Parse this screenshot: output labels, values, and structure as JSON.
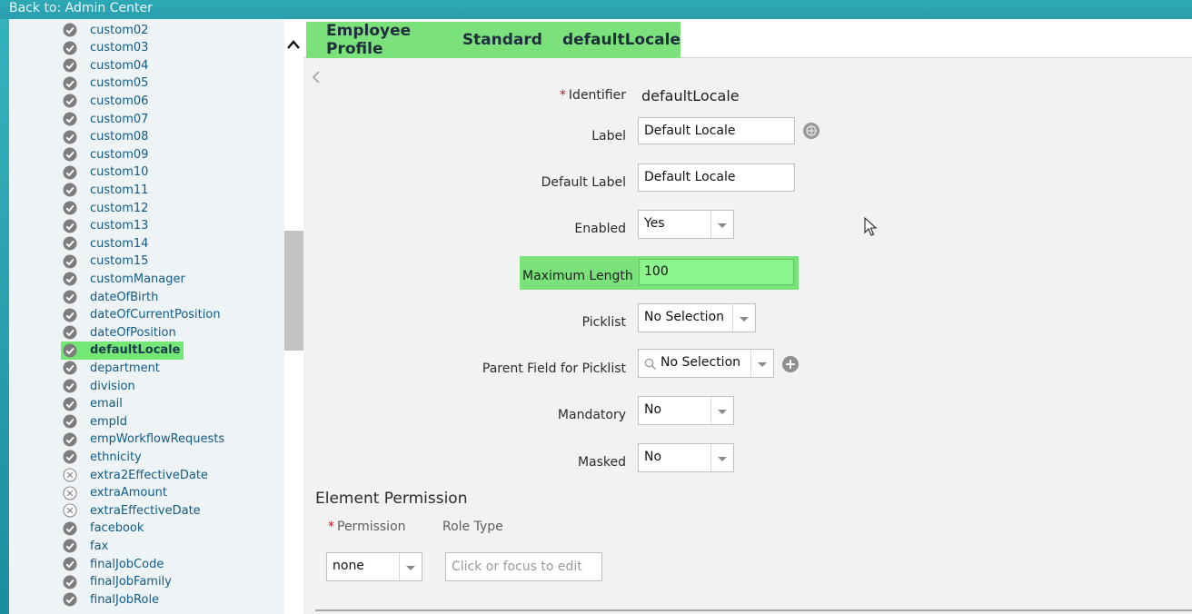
{
  "topbar": {
    "back_link": "Back to: Admin Center"
  },
  "sidebar": {
    "items": [
      {
        "label": "custom02",
        "status": "check"
      },
      {
        "label": "custom03",
        "status": "check"
      },
      {
        "label": "custom04",
        "status": "check"
      },
      {
        "label": "custom05",
        "status": "check"
      },
      {
        "label": "custom06",
        "status": "check"
      },
      {
        "label": "custom07",
        "status": "check"
      },
      {
        "label": "custom08",
        "status": "check"
      },
      {
        "label": "custom09",
        "status": "check"
      },
      {
        "label": "custom10",
        "status": "check"
      },
      {
        "label": "custom11",
        "status": "check"
      },
      {
        "label": "custom12",
        "status": "check"
      },
      {
        "label": "custom13",
        "status": "check"
      },
      {
        "label": "custom14",
        "status": "check"
      },
      {
        "label": "custom15",
        "status": "check"
      },
      {
        "label": "customManager",
        "status": "check"
      },
      {
        "label": "dateOfBirth",
        "status": "check"
      },
      {
        "label": "dateOfCurrentPosition",
        "status": "check"
      },
      {
        "label": "dateOfPosition",
        "status": "check"
      },
      {
        "label": "defaultLocale",
        "status": "check",
        "selected": true
      },
      {
        "label": "department",
        "status": "check"
      },
      {
        "label": "division",
        "status": "check"
      },
      {
        "label": "email",
        "status": "check"
      },
      {
        "label": "empId",
        "status": "check"
      },
      {
        "label": "empWorkflowRequests",
        "status": "check"
      },
      {
        "label": "ethnicity",
        "status": "check"
      },
      {
        "label": "extra2EffectiveDate",
        "status": "cross"
      },
      {
        "label": "extraAmount",
        "status": "cross"
      },
      {
        "label": "extraEffectiveDate",
        "status": "cross"
      },
      {
        "label": "facebook",
        "status": "check"
      },
      {
        "label": "fax",
        "status": "check"
      },
      {
        "label": "finalJobCode",
        "status": "check"
      },
      {
        "label": "finalJobFamily",
        "status": "check"
      },
      {
        "label": "finalJobRole",
        "status": "check"
      }
    ]
  },
  "breadcrumb": [
    "Employee Profile",
    "Standard",
    "defaultLocale"
  ],
  "form": {
    "identifier_label": "Identifier",
    "identifier_value": "defaultLocale",
    "label_label": "Label",
    "label_value": "Default Locale",
    "default_label_label": "Default Label",
    "default_label_value": "Default Locale",
    "enabled_label": "Enabled",
    "enabled_value": "Yes",
    "max_length_label": "Maximum Length",
    "max_length_value": "100",
    "picklist_label": "Picklist",
    "picklist_value": "No Selection",
    "parent_field_label": "Parent Field for Picklist",
    "parent_field_value": "No Selection",
    "mandatory_label": "Mandatory",
    "mandatory_value": "No",
    "masked_label": "Masked",
    "masked_value": "No"
  },
  "permission": {
    "section_title": "Element Permission",
    "permission_label": "Permission",
    "role_type_label": "Role Type",
    "permission_value": "none",
    "role_type_placeholder": "Click or focus to edit"
  },
  "colors": {
    "highlight": "#7be27b",
    "topbar": "#2a9eae",
    "link": "#105b86",
    "required": "#c6132b"
  }
}
